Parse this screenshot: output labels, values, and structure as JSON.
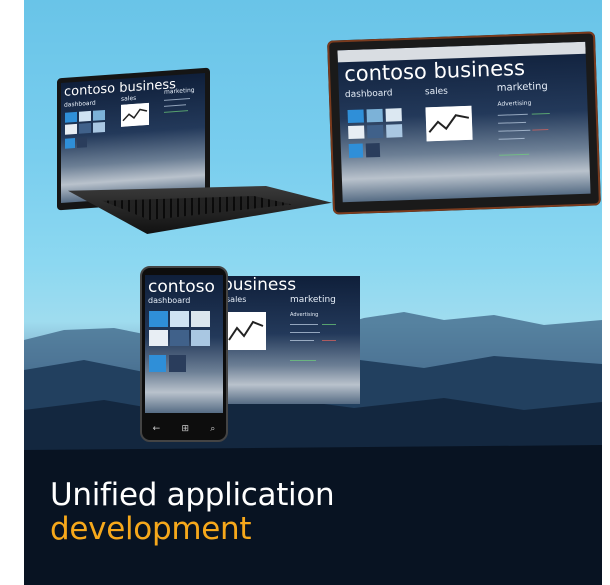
{
  "app": {
    "title": "contoso business",
    "sections": {
      "dashboard": "dashboard",
      "sales": "sales",
      "marketing": "marketing"
    },
    "marketing_sub": "Advertising"
  },
  "caption": {
    "line1": "Unified application",
    "line2": "development"
  },
  "phone_buttons": [
    "←",
    "⊞",
    "⌕"
  ],
  "colors": {
    "sky_top": "#69c4e8",
    "caption_white": "#ffffff",
    "caption_accent": "#f6a81b",
    "tile_blue": "#2f8fd8"
  }
}
